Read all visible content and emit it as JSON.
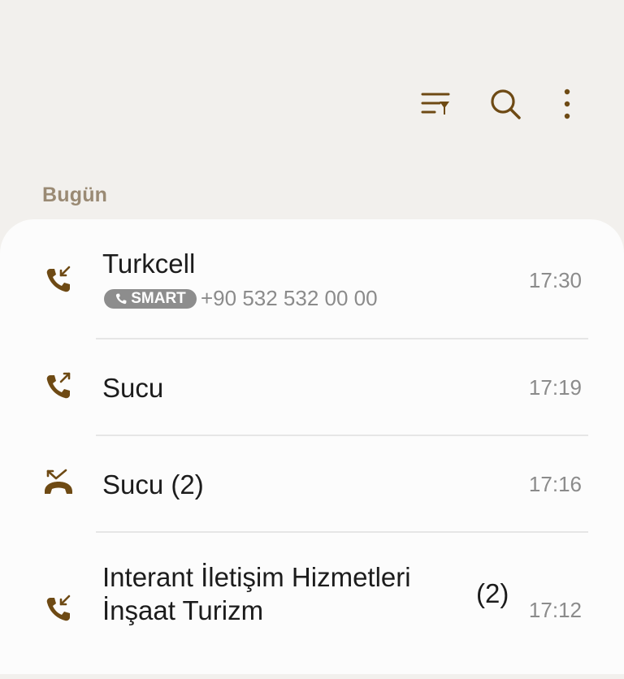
{
  "toolbar": {
    "filter_icon": "filter-list-icon",
    "search_icon": "search-icon",
    "more_icon": "more-vert-icon",
    "accent": "#6e4a14"
  },
  "section": {
    "title": "Bugün"
  },
  "calls": [
    {
      "name": "Turkcell",
      "badge": "SMART",
      "number": "+90 532 532 00 00",
      "time": "17:30",
      "type": "incoming",
      "icon": "incoming-call-icon"
    },
    {
      "name": "Sucu",
      "time": "17:19",
      "type": "outgoing",
      "icon": "outgoing-call-icon"
    },
    {
      "name": "Sucu (2)",
      "time": "17:16",
      "type": "missed",
      "icon": "missed-call-icon"
    },
    {
      "name_line1": "Interant İletişim Hizmetleri",
      "name_line2": "İnşaat Turizm",
      "count": "(2)",
      "time": "17:12",
      "type": "incoming",
      "icon": "incoming-call-icon"
    }
  ]
}
